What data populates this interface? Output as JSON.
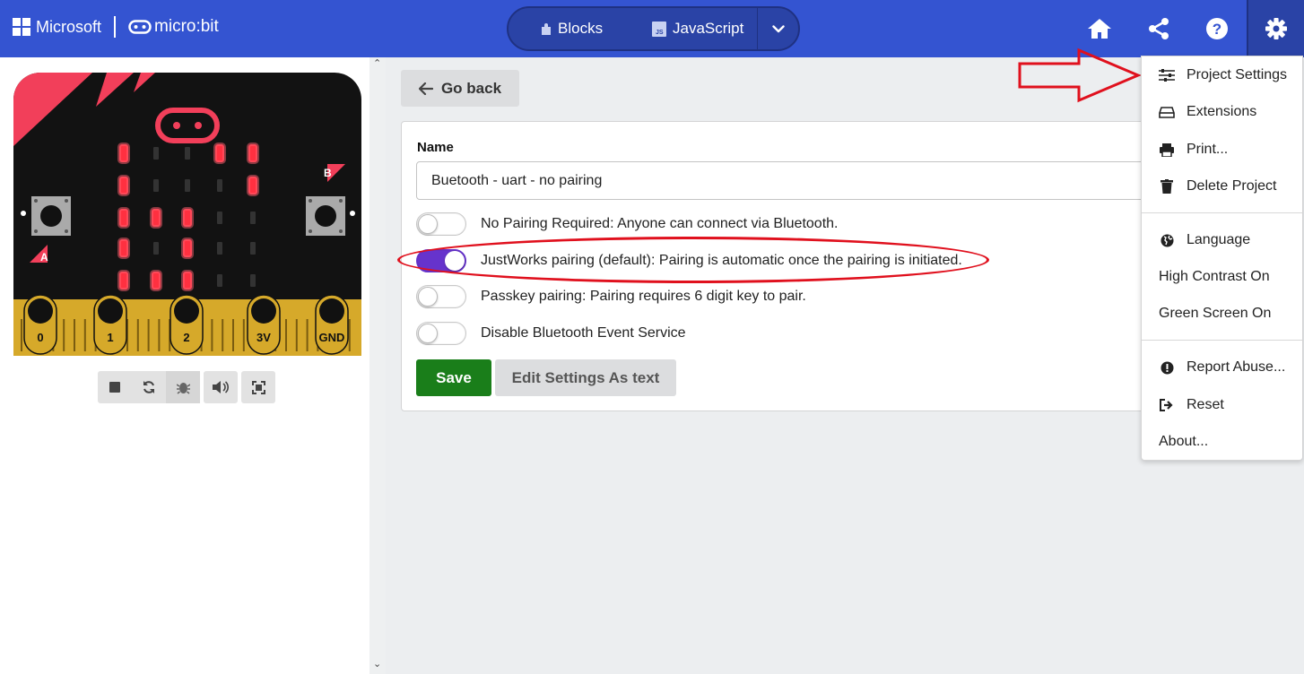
{
  "header": {
    "brand": "Microsoft",
    "product": "micro:bit",
    "editor_tabs": [
      {
        "label": "Blocks",
        "icon": "puzzle-icon"
      },
      {
        "label": "JavaScript",
        "icon": "js-file-icon"
      }
    ],
    "icons": [
      "home-icon",
      "share-icon",
      "help-icon",
      "gear-icon"
    ]
  },
  "simulator": {
    "pin_labels": [
      "0",
      "1",
      "2",
      "3V",
      "GND"
    ],
    "button_a": "A",
    "button_b": "B",
    "led_grid": [
      [
        1,
        0,
        0,
        1,
        1
      ],
      [
        1,
        0,
        0,
        0,
        1
      ],
      [
        1,
        1,
        1,
        0,
        0
      ],
      [
        1,
        0,
        1,
        0,
        0
      ],
      [
        1,
        1,
        1,
        0,
        0
      ]
    ],
    "controls": [
      "stop-icon",
      "restart-icon",
      "debug-icon",
      "sound-icon",
      "fullscreen-icon"
    ]
  },
  "main": {
    "go_back": "Go back",
    "name_label": "Name",
    "name_value": "Buetooth - uart - no pairing",
    "options": [
      {
        "label": "No Pairing Required: Anyone can connect via Bluetooth.",
        "on": false
      },
      {
        "label": "JustWorks pairing (default): Pairing is automatic once the pairing is initiated.",
        "on": true
      },
      {
        "label": "Passkey pairing: Pairing requires 6 digit key to pair.",
        "on": false
      },
      {
        "label": "Disable Bluetooth Event Service",
        "on": false
      }
    ],
    "save": "Save",
    "edit_as_text": "Edit Settings As text"
  },
  "menu": {
    "items": [
      {
        "label": "Project Settings",
        "icon": "sliders-icon"
      },
      {
        "label": "Extensions",
        "icon": "drive-icon"
      },
      {
        "label": "Print...",
        "icon": "printer-icon"
      },
      {
        "label": "Delete Project",
        "icon": "trash-icon"
      },
      {
        "label": "Language",
        "icon": "globe-icon"
      },
      {
        "label": "High Contrast On",
        "icon": ""
      },
      {
        "label": "Green Screen On",
        "icon": ""
      },
      {
        "label": "Report Abuse...",
        "icon": "alert-circle-icon"
      },
      {
        "label": "Reset",
        "icon": "sign-out-icon"
      },
      {
        "label": "About...",
        "icon": ""
      }
    ]
  },
  "colors": {
    "header": "#3454D1",
    "toggle_on": "#6633CC",
    "save": "#1A7E1A",
    "annotation": "#E0101D",
    "led_on": "#FF3040"
  }
}
